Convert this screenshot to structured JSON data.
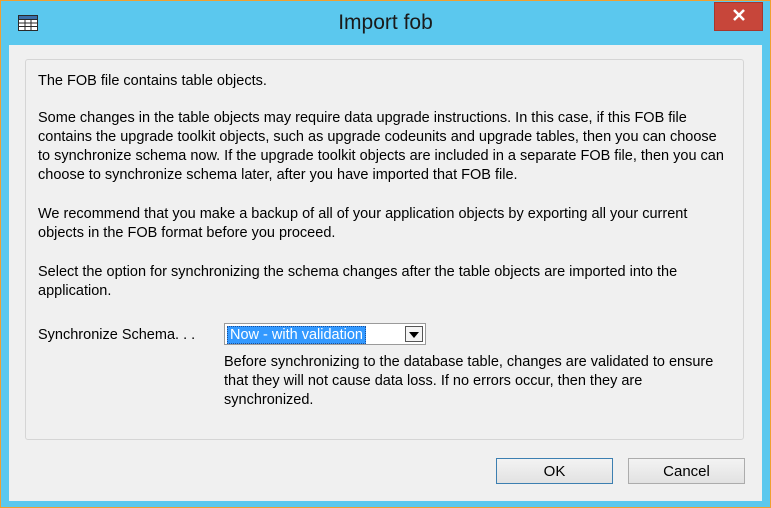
{
  "window": {
    "title": "Import fob",
    "icon": "table-grid-icon",
    "close_icon": "close-x-icon"
  },
  "content": {
    "paragraph1": "The FOB file contains table objects.",
    "paragraph2": "Some changes in the table objects may require data upgrade instructions. In this case, if this FOB file contains the upgrade toolkit objects, such as upgrade codeunits and upgrade tables, then you can choose to synchronize schema now. If the upgrade toolkit objects are included in a separate FOB file, then you can choose to synchronize schema later, after you have imported that FOB file.",
    "paragraph3": "We recommend that you make a backup of all of your application objects by exporting all your current objects in the FOB format before you proceed.",
    "paragraph4": "Select the option for synchronizing the schema changes after the table objects are imported into the application."
  },
  "sync": {
    "label": "Synchronize Schema. . .",
    "selected_value": "Now - with validation",
    "description": "Before synchronizing to the database table, changes are validated to ensure that they will not cause data loss. If no errors occur, then they are synchronized."
  },
  "buttons": {
    "ok": "OK",
    "cancel": "Cancel"
  },
  "colors": {
    "frame": "#5bc8ee",
    "close_button": "#c7463a",
    "selection": "#3399ff"
  }
}
